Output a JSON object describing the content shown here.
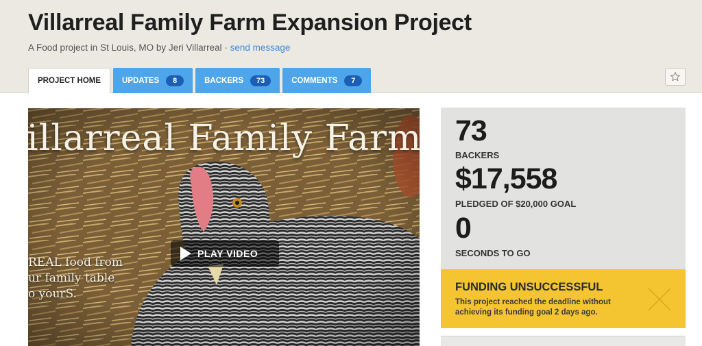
{
  "project": {
    "title": "Villarreal Family Farm Expansion Project",
    "subtitle_prefix": "A Food project in St Louis, MO by Jeri Villarreal · ",
    "send_message": "send message"
  },
  "tabs": [
    {
      "label": "Project Home"
    },
    {
      "label": "Updates",
      "count": "8"
    },
    {
      "label": "Backers",
      "count": "73"
    },
    {
      "label": "Comments",
      "count": "7"
    }
  ],
  "video": {
    "overlay_title": "illarreal Family Farm",
    "caption_line1": "REAL food from",
    "caption_line2": "ur family table",
    "caption_line3": "o yourS.",
    "play_label": "PLAY VIDEO"
  },
  "stats": {
    "backers_value": "73",
    "backers_label": "Backers",
    "pledged_value": "$17,558",
    "pledged_label": "Pledged of $20,000 goal",
    "time_value": "0",
    "time_label": "Seconds to go"
  },
  "status": {
    "title": "Funding Unsuccessful",
    "text": "This project reached the deadline without achieving its funding goal 2 days ago."
  },
  "icons": {
    "star": "star-icon",
    "play": "play-icon",
    "close": "x-icon"
  },
  "colors": {
    "tab_blue": "#4ea5ea",
    "badge_blue": "#1b5fb4",
    "status_yellow": "#f4c531",
    "link_blue": "#3d8cd6"
  }
}
